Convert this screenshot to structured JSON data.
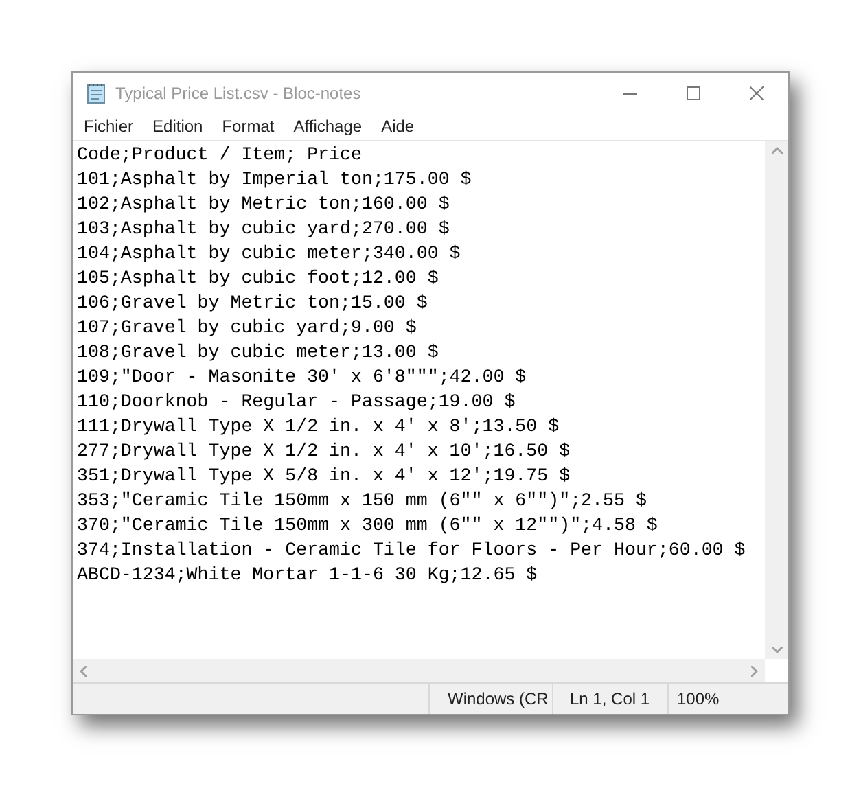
{
  "window": {
    "title": "Typical Price List.csv - Bloc-notes"
  },
  "menu": [
    "Fichier",
    "Edition",
    "Format",
    "Affichage",
    "Aide"
  ],
  "lines": [
    "Code;Product / Item; Price",
    "101;Asphalt by Imperial ton;175.00 $",
    "102;Asphalt by Metric ton;160.00 $",
    "103;Asphalt by cubic yard;270.00 $",
    "104;Asphalt by cubic meter;340.00 $",
    "105;Asphalt by cubic foot;12.00 $",
    "106;Gravel by Metric ton;15.00 $",
    "107;Gravel by cubic yard;9.00 $",
    "108;Gravel by cubic meter;13.00 $",
    "109;\"Door - Masonite 30' x 6'8\"\"\";42.00 $",
    "110;Doorknob - Regular - Passage;19.00 $",
    "111;Drywall Type X 1/2 in. x 4' x 8';13.50 $",
    "277;Drywall Type X 1/2 in. x 4' x 10';16.50 $",
    "351;Drywall Type X 5/8 in. x 4' x 12';19.75 $",
    "353;\"Ceramic Tile 150mm x 150 mm (6\"\" x 6\"\")\";2.55 $",
    "370;\"Ceramic Tile 150mm x 300 mm (6\"\" x 12\"\")\";4.58 $",
    "374;Installation - Ceramic Tile for Floors - Per Hour;60.00 $",
    "ABCD-1234;White Mortar 1-1-6 30 Kg;12.65 $"
  ],
  "status_bar": {
    "line_ending": "Windows (CR",
    "position": "Ln 1, Col 1",
    "zoom": "100%"
  }
}
